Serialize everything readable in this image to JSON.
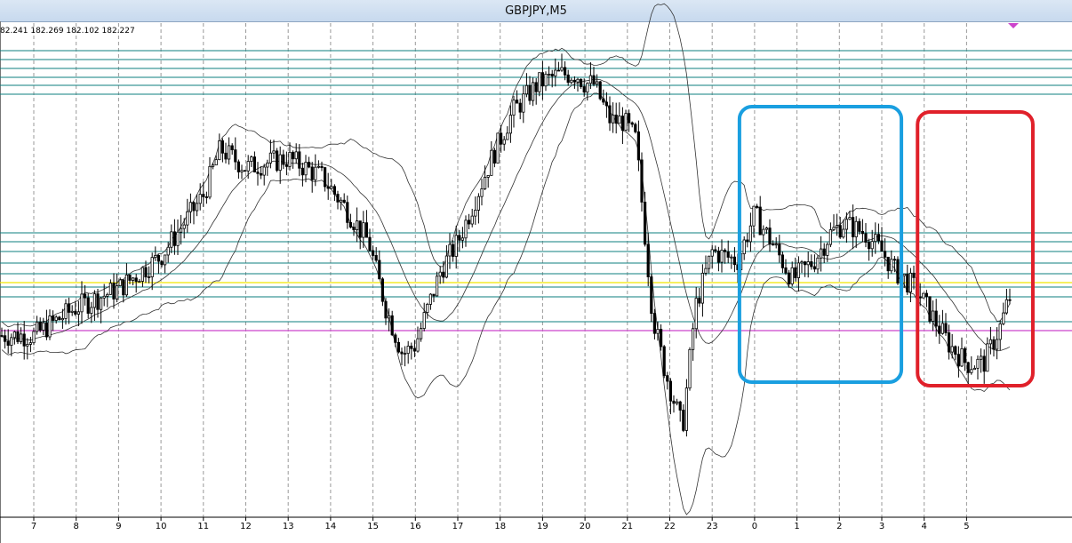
{
  "window": {
    "title": "GBPJPY,M5"
  },
  "info": {
    "ohlc": "82.241 182.269 182.102 182.227"
  },
  "chart_data": {
    "type": "candlestick",
    "symbol": "GBPJPY",
    "timeframe": "M5",
    "x_tick_labels": [
      "7",
      "8",
      "9",
      "10",
      "11",
      "12",
      "13",
      "14",
      "15",
      "16",
      "17",
      "18",
      "19",
      "20",
      "21",
      "22",
      "23",
      "0",
      "1",
      "2",
      "3",
      "4",
      "5"
    ],
    "grid": true,
    "indicator": "Bollinger Bands",
    "price_path": [
      [
        0,
        182.02
      ],
      [
        1,
        182.08
      ],
      [
        2,
        182.12
      ],
      [
        3,
        182.19
      ],
      [
        4,
        182.32
      ],
      [
        4.4,
        182.42
      ],
      [
        5,
        182.38
      ],
      [
        6,
        182.4
      ],
      [
        6.8,
        182.36
      ],
      [
        7.3,
        182.3
      ],
      [
        7.9,
        182.22
      ],
      [
        8.3,
        182.08
      ],
      [
        8.7,
        181.98
      ],
      [
        9,
        182.0
      ],
      [
        9.6,
        182.16
      ],
      [
        10,
        182.22
      ],
      [
        10.8,
        182.4
      ],
      [
        11.3,
        182.5
      ],
      [
        11.9,
        182.56
      ],
      [
        12.4,
        182.58
      ],
      [
        12.8,
        182.58
      ],
      [
        13,
        182.56
      ],
      [
        13.2,
        182.56
      ],
      [
        13.6,
        182.48
      ],
      [
        13.9,
        182.48
      ],
      [
        14.2,
        182.44
      ],
      [
        14.6,
        182.06
      ],
      [
        14.9,
        181.94
      ],
      [
        15.3,
        181.82
      ],
      [
        15.6,
        182.08
      ],
      [
        16,
        182.2
      ],
      [
        16.6,
        182.18
      ],
      [
        17,
        182.28
      ],
      [
        17.4,
        182.22
      ],
      [
        17.9,
        182.14
      ],
      [
        18.4,
        182.18
      ],
      [
        18.8,
        182.24
      ],
      [
        19.1,
        182.26
      ],
      [
        19.6,
        182.24
      ],
      [
        20,
        182.2
      ],
      [
        20.3,
        182.16
      ],
      [
        20.8,
        182.12
      ],
      [
        21.2,
        182.06
      ],
      [
        21.6,
        182.0
      ],
      [
        22,
        181.96
      ],
      [
        22.4,
        181.96
      ],
      [
        22.8,
        182.04
      ],
      [
        23,
        182.1
      ],
      [
        23.6,
        182.12
      ]
    ],
    "annotations": [
      {
        "type": "rectangle",
        "color": "#1a9fe0",
        "x_range": [
          17.0,
          20.4
        ],
        "label": ""
      },
      {
        "type": "rectangle",
        "color": "#e0202a",
        "x_range": [
          21.2,
          23.5
        ],
        "label": ""
      }
    ],
    "horizontal_lines": [
      {
        "color": "#0e7f7f",
        "count": 13
      },
      {
        "color": "#f2e600",
        "count": 1
      },
      {
        "color": "#cc44cc",
        "count": 1
      }
    ],
    "colors": {
      "candle": "#000000",
      "bands": "#333333",
      "teal": "#0e7f7f",
      "yellow": "#f2e600",
      "magenta": "#cc44cc",
      "blue": "#1a9fe0",
      "red": "#e0202a"
    }
  }
}
